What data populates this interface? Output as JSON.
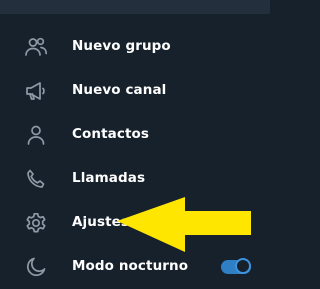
{
  "menu": {
    "items": [
      {
        "label": "Nuevo grupo",
        "icon": "group-icon"
      },
      {
        "label": "Nuevo canal",
        "icon": "megaphone-icon"
      },
      {
        "label": "Contactos",
        "icon": "contact-icon"
      },
      {
        "label": "Llamadas",
        "icon": "phone-icon"
      },
      {
        "label": "Ajustes",
        "icon": "gear-icon"
      },
      {
        "label": "Modo nocturno",
        "icon": "moon-icon"
      }
    ],
    "night_mode_enabled": true
  },
  "colors": {
    "background": "#17212b",
    "text": "#ffffff",
    "icon": "#8f9aa6",
    "accent": "#2f7fc4",
    "annotation_arrow": "#ffe600"
  }
}
